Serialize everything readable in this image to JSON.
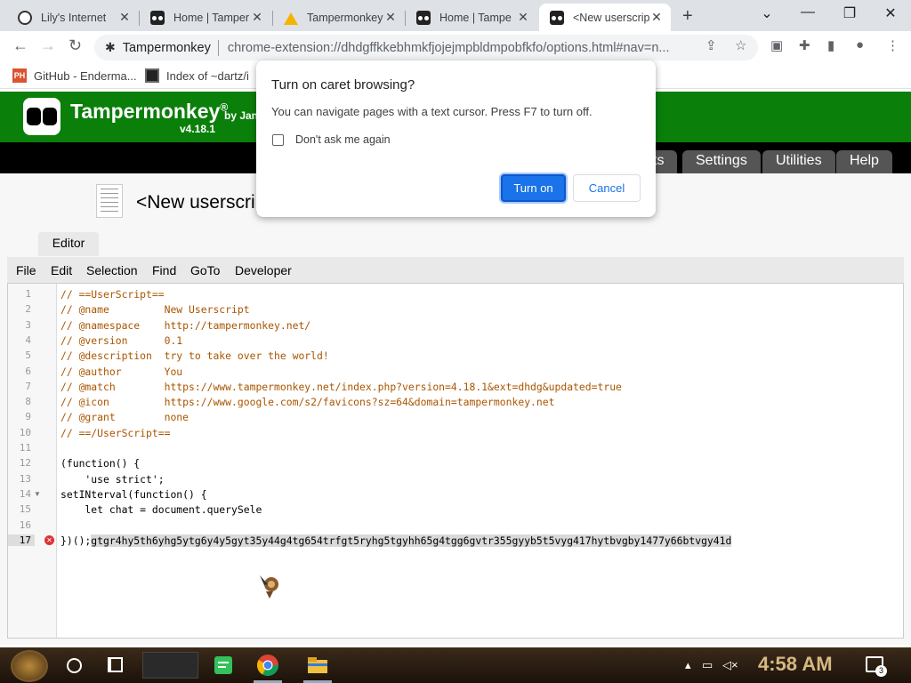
{
  "browser": {
    "tabs": [
      {
        "label": "Lily's Internet",
        "icon": "github-icon"
      },
      {
        "label": "Home | Tamper",
        "icon": "tampermonkey-icon"
      },
      {
        "label": "Tampermonkey",
        "icon": "google-drive-icon"
      },
      {
        "label": "Home | Tampe",
        "icon": "tampermonkey-icon"
      },
      {
        "label": "<New userscrip",
        "icon": "tampermonkey-icon",
        "active": true
      }
    ],
    "close_glyph": "✕",
    "newtab_glyph": "+",
    "window_controls": {
      "dropdown": "⌄",
      "minimize": "—",
      "restore": "❐",
      "close": "✕"
    },
    "omnibox": {
      "site": "Tampermonkey",
      "url": "chrome-extension://dhdgffkkebhmkfjojejmpbldmpobfkfo/options.html#nav=n..."
    },
    "bookmarks": [
      {
        "label": "GitHub - Enderma...",
        "icon": "producthunt-icon",
        "icon_text": "PH"
      },
      {
        "label": "Index of ~dartz/i",
        "icon": "index-icon"
      }
    ]
  },
  "tampermonkey": {
    "brand": "Tampermonkey",
    "registered": "®",
    "by": "by Jan",
    "version": "v4.18.1",
    "nav_tabs": [
      "ts",
      "Settings",
      "Utilities",
      "Help"
    ],
    "script_title": "<New userscrip",
    "editor_tab": "Editor",
    "menu": [
      "File",
      "Edit",
      "Selection",
      "Find",
      "GoTo",
      "Developer"
    ]
  },
  "code": {
    "lines": [
      {
        "n": "1",
        "text": "// ==UserScript=="
      },
      {
        "n": "2",
        "text": "// @name         New Userscript"
      },
      {
        "n": "3",
        "text": "// @namespace    http://tampermonkey.net/"
      },
      {
        "n": "4",
        "text": "// @version      0.1"
      },
      {
        "n": "5",
        "text": "// @description  try to take over the world!"
      },
      {
        "n": "6",
        "text": "// @author       You"
      },
      {
        "n": "7",
        "text": "// @match        https://www.tampermonkey.net/index.php?version=4.18.1&ext=dhdg&updated=true"
      },
      {
        "n": "8",
        "text": "// @icon         https://www.google.com/s2/favicons?sz=64&domain=tampermonkey.net"
      },
      {
        "n": "9",
        "text": "// @grant        none"
      },
      {
        "n": "10",
        "text": "// ==/UserScript=="
      },
      {
        "n": "11",
        "text": ""
      },
      {
        "n": "12",
        "text": "(function() {"
      },
      {
        "n": "13",
        "text": "    'use strict';"
      },
      {
        "n": "14",
        "text": "setINterval(function() {"
      },
      {
        "n": "15",
        "text": "    let chat = document.querySele"
      },
      {
        "n": "16",
        "text": ""
      },
      {
        "n": "17",
        "text": "})();",
        "selected": "gtgr4hy5th6yhg5ytg6y4y5gyt35y44g4tg654trfgt5ryhg5tgyhh65g4tgg6gvtr355gyyb5t5vyg417hytbvgby1477y66btvgy41d"
      }
    ],
    "fold_marker": "▼",
    "error_marker": "✕"
  },
  "dialog": {
    "title": "Turn on caret browsing?",
    "body": "You can navigate pages with a text cursor. Press F7 to turn off.",
    "checkbox_label": "Don't ask me again",
    "primary_button": "Turn on",
    "secondary_button": "Cancel"
  },
  "taskbar": {
    "clock": "4:58 AM",
    "notification_count": "3"
  },
  "colors": {
    "tm_green": "#0a7f0a",
    "chrome_blue": "#1a73e8",
    "selection": "#d9d9d9"
  }
}
